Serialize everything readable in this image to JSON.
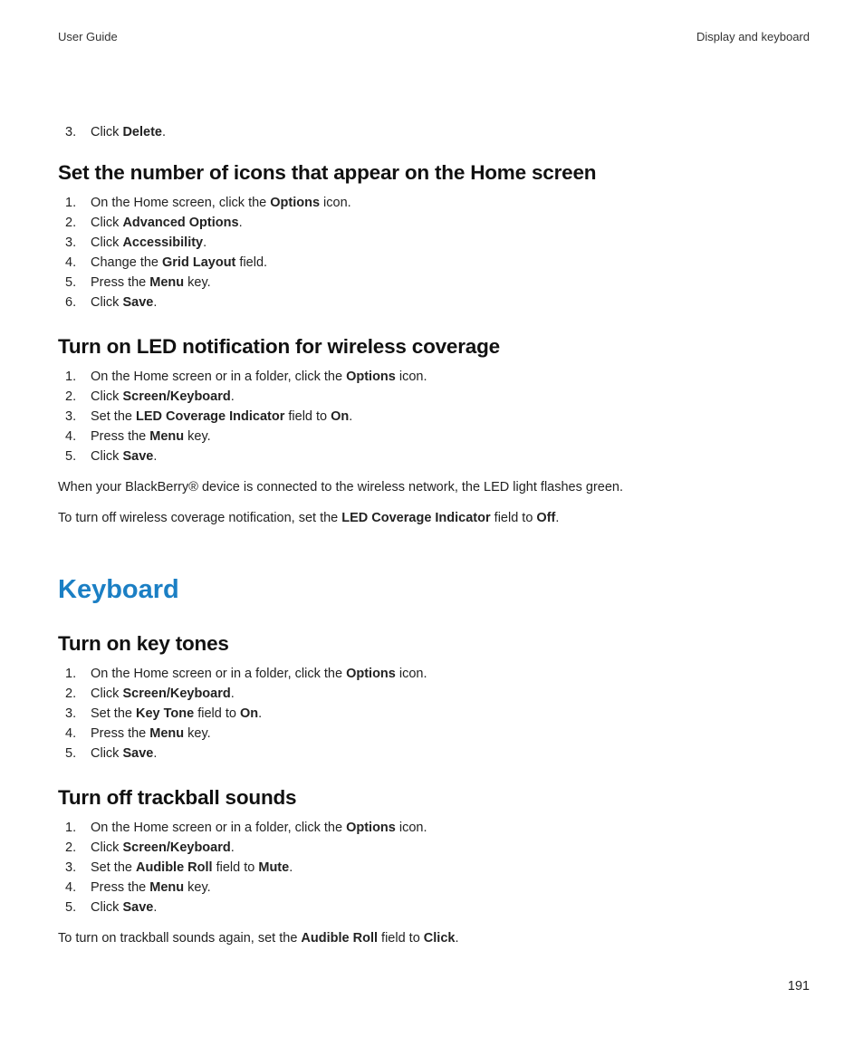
{
  "header": {
    "left": "User Guide",
    "right": "Display and keyboard"
  },
  "pageNumber": "191",
  "orphan": {
    "num": "3.",
    "parts": [
      {
        "t": "Click ",
        "b": false
      },
      {
        "t": "Delete",
        "b": true
      },
      {
        "t": ".",
        "b": false
      }
    ]
  },
  "sections": [
    {
      "heading": "Set the number of icons that appear on the Home screen",
      "steps": [
        [
          {
            "t": "On the Home screen, click the ",
            "b": false
          },
          {
            "t": "Options",
            "b": true
          },
          {
            "t": " icon.",
            "b": false
          }
        ],
        [
          {
            "t": "Click ",
            "b": false
          },
          {
            "t": "Advanced Options",
            "b": true
          },
          {
            "t": ".",
            "b": false
          }
        ],
        [
          {
            "t": "Click ",
            "b": false
          },
          {
            "t": "Accessibility",
            "b": true
          },
          {
            "t": ".",
            "b": false
          }
        ],
        [
          {
            "t": "Change the ",
            "b": false
          },
          {
            "t": "Grid Layout",
            "b": true
          },
          {
            "t": " field.",
            "b": false
          }
        ],
        [
          {
            "t": "Press the ",
            "b": false
          },
          {
            "t": "Menu",
            "b": true
          },
          {
            "t": " key.",
            "b": false
          }
        ],
        [
          {
            "t": "Click ",
            "b": false
          },
          {
            "t": "Save",
            "b": true
          },
          {
            "t": ".",
            "b": false
          }
        ]
      ],
      "paras": []
    },
    {
      "heading": "Turn on LED notification for wireless coverage",
      "steps": [
        [
          {
            "t": "On the Home screen or in a folder, click the ",
            "b": false
          },
          {
            "t": "Options",
            "b": true
          },
          {
            "t": " icon.",
            "b": false
          }
        ],
        [
          {
            "t": "Click ",
            "b": false
          },
          {
            "t": "Screen/Keyboard",
            "b": true
          },
          {
            "t": ".",
            "b": false
          }
        ],
        [
          {
            "t": "Set the ",
            "b": false
          },
          {
            "t": "LED Coverage Indicator",
            "b": true
          },
          {
            "t": " field to ",
            "b": false
          },
          {
            "t": "On",
            "b": true
          },
          {
            "t": ".",
            "b": false
          }
        ],
        [
          {
            "t": "Press the ",
            "b": false
          },
          {
            "t": "Menu",
            "b": true
          },
          {
            "t": " key.",
            "b": false
          }
        ],
        [
          {
            "t": "Click ",
            "b": false
          },
          {
            "t": "Save",
            "b": true
          },
          {
            "t": ".",
            "b": false
          }
        ]
      ],
      "paras": [
        [
          {
            "t": "When your BlackBerry® device is connected to the wireless network, the LED light flashes green.",
            "b": false
          }
        ],
        [
          {
            "t": "To turn off wireless coverage notification, set the ",
            "b": false
          },
          {
            "t": "LED Coverage Indicator",
            "b": true
          },
          {
            "t": " field to ",
            "b": false
          },
          {
            "t": "Off",
            "b": true
          },
          {
            "t": ".",
            "b": false
          }
        ]
      ]
    }
  ],
  "chapter": {
    "title": "Keyboard",
    "sections": [
      {
        "heading": "Turn on key tones",
        "steps": [
          [
            {
              "t": "On the Home screen or in a folder, click the ",
              "b": false
            },
            {
              "t": "Options",
              "b": true
            },
            {
              "t": " icon.",
              "b": false
            }
          ],
          [
            {
              "t": "Click ",
              "b": false
            },
            {
              "t": "Screen/Keyboard",
              "b": true
            },
            {
              "t": ".",
              "b": false
            }
          ],
          [
            {
              "t": "Set the ",
              "b": false
            },
            {
              "t": "Key Tone",
              "b": true
            },
            {
              "t": " field to ",
              "b": false
            },
            {
              "t": "On",
              "b": true
            },
            {
              "t": ".",
              "b": false
            }
          ],
          [
            {
              "t": "Press the ",
              "b": false
            },
            {
              "t": "Menu",
              "b": true
            },
            {
              "t": " key.",
              "b": false
            }
          ],
          [
            {
              "t": "Click ",
              "b": false
            },
            {
              "t": "Save",
              "b": true
            },
            {
              "t": ".",
              "b": false
            }
          ]
        ],
        "paras": []
      },
      {
        "heading": "Turn off trackball sounds",
        "steps": [
          [
            {
              "t": "On the Home screen or in a folder, click the ",
              "b": false
            },
            {
              "t": "Options",
              "b": true
            },
            {
              "t": " icon.",
              "b": false
            }
          ],
          [
            {
              "t": "Click ",
              "b": false
            },
            {
              "t": "Screen/Keyboard",
              "b": true
            },
            {
              "t": ".",
              "b": false
            }
          ],
          [
            {
              "t": "Set the ",
              "b": false
            },
            {
              "t": "Audible Roll",
              "b": true
            },
            {
              "t": " field to ",
              "b": false
            },
            {
              "t": "Mute",
              "b": true
            },
            {
              "t": ".",
              "b": false
            }
          ],
          [
            {
              "t": "Press the ",
              "b": false
            },
            {
              "t": "Menu",
              "b": true
            },
            {
              "t": " key.",
              "b": false
            }
          ],
          [
            {
              "t": "Click ",
              "b": false
            },
            {
              "t": "Save",
              "b": true
            },
            {
              "t": ".",
              "b": false
            }
          ]
        ],
        "paras": [
          [
            {
              "t": "To turn on trackball sounds again, set the ",
              "b": false
            },
            {
              "t": "Audible Roll",
              "b": true
            },
            {
              "t": " field to ",
              "b": false
            },
            {
              "t": "Click",
              "b": true
            },
            {
              "t": ".",
              "b": false
            }
          ]
        ]
      }
    ]
  }
}
